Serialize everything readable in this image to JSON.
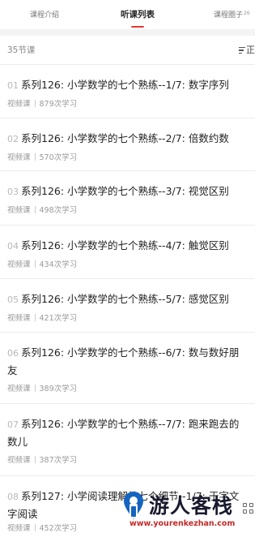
{
  "tabs": [
    {
      "label": "课程介绍",
      "active": false
    },
    {
      "label": "听课列表",
      "active": true
    },
    {
      "label": "课程圈子",
      "badge": "26",
      "active": false
    }
  ],
  "list_header": {
    "count_label": "35节课",
    "sort_label": "正"
  },
  "lessons": [
    {
      "num": "01",
      "title": "系列126: 小学数学的七个熟练--1/7: 数字序列",
      "type": "视频课",
      "views": "879次学习"
    },
    {
      "num": "02",
      "title": "系列126: 小学数学的七个熟练--2/7: 倍数约数",
      "type": "视频课",
      "views": "570次学习"
    },
    {
      "num": "03",
      "title": "系列126: 小学数学的七个熟练--3/7: 视觉区别",
      "type": "视频课",
      "views": "498次学习"
    },
    {
      "num": "04",
      "title": "系列126: 小学数学的七个熟练--4/7: 触觉区别",
      "type": "视频课",
      "views": "434次学习"
    },
    {
      "num": "05",
      "title": "系列126: 小学数学的七个熟练--5/7: 感觉区别",
      "type": "视频课",
      "views": "421次学习"
    },
    {
      "num": "06",
      "title": "系列126: 小学数学的七个熟练--6/7: 数与数好朋友",
      "type": "视频课",
      "views": "389次学习"
    },
    {
      "num": "07",
      "title": "系列126: 小学数学的七个熟练--7/7: 跑来跑去的数儿",
      "type": "视频课",
      "views": "387次学习"
    },
    {
      "num": "08",
      "title": "系列127: 小学阅读理解的七个细节--1/7: 于字文字阅读",
      "type": "视频课",
      "views": "452次学习"
    }
  ],
  "watermark": {
    "title": "游人客栈",
    "url": "www.yourenkezhan.com"
  },
  "colors": {
    "accent": "#e53935",
    "divider": "#ececec",
    "muted": "#999999"
  }
}
